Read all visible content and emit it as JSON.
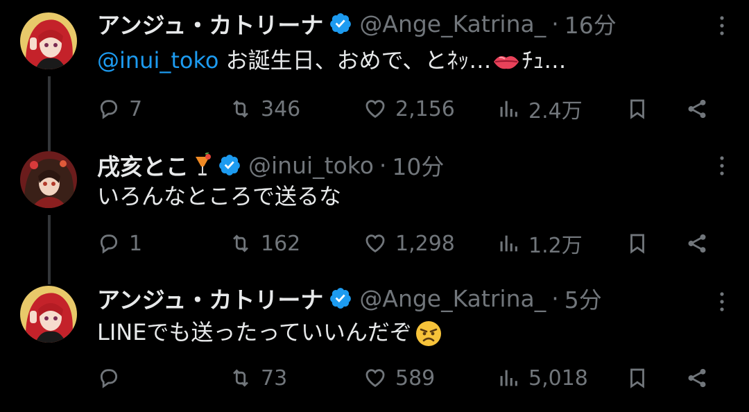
{
  "tweets": [
    {
      "name": "アンジュ・カトリーナ",
      "handle": "@Ange_Katrina_",
      "separator": "·",
      "time": "16分",
      "mention": "@inui_toko",
      "text": " お誕生日、おめで、とﾈｯ…",
      "text_after_emoji": "ﾁｭ…",
      "emoji": "lips",
      "replies": "7",
      "retweets": "346",
      "likes": "2,156",
      "views": "2.4万"
    },
    {
      "name": "戌亥とこ",
      "handle": "@inui_toko",
      "separator": "·",
      "time": "10分",
      "text": "いろんなところで送るな",
      "replies": "1",
      "retweets": "162",
      "likes": "1,298",
      "views": "1.2万"
    },
    {
      "name": "アンジュ・カトリーナ",
      "handle": "@Ange_Katrina_",
      "separator": "·",
      "time": "5分",
      "text": "LINEでも送ったっていいんだぞ",
      "emoji": "angry-face",
      "replies": "",
      "retweets": "73",
      "likes": "589",
      "views": "5,018"
    }
  ],
  "colors": {
    "background": "#000000",
    "text": "#e7e9ea",
    "muted": "#71767b",
    "link": "#1d9bf0",
    "verified": "#1d9bf0"
  },
  "icons": [
    "reply-icon",
    "retweet-icon",
    "like-icon",
    "views-icon",
    "bookmark-icon",
    "share-icon",
    "more-icon",
    "verified-badge-icon"
  ]
}
